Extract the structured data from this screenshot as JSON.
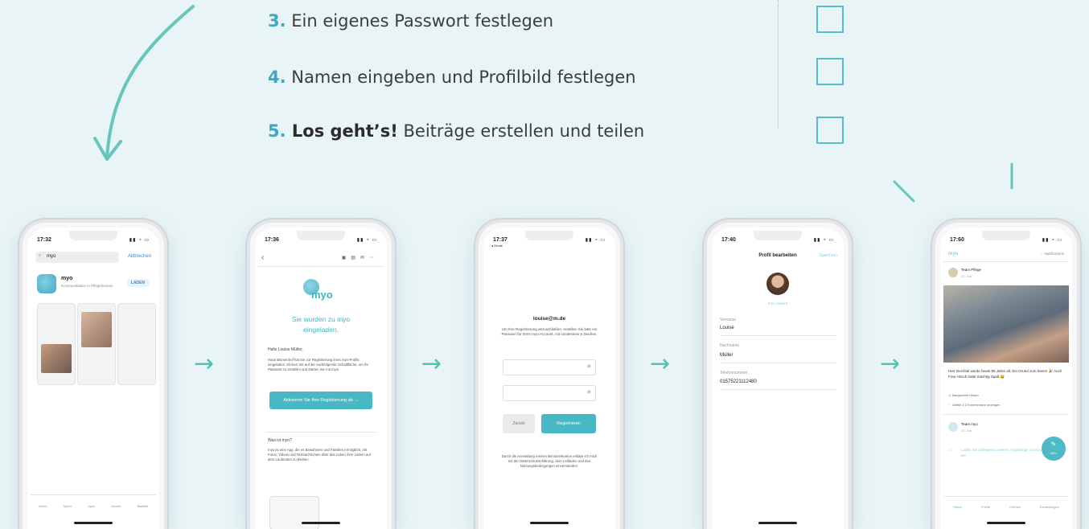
{
  "steps": [
    {
      "num": "3.",
      "bold": "",
      "text": " Ein eigenes Passwort festlegen"
    },
    {
      "num": "4.",
      "bold": "",
      "text": " Namen eingeben und Profilbild festlegen"
    },
    {
      "num": "5.",
      "bold": " Los geht’s!",
      "text": " Beiträge erstellen und teilen"
    }
  ],
  "arrow_glyph": "→",
  "colors": {
    "accent": "#3aa8c6",
    "teal": "#4fc3b3",
    "checkbox": "#5cb9d2"
  },
  "phone1": {
    "time": "17:32",
    "search_value": "myo",
    "cancel": "Abbrechen",
    "app_name": "myo",
    "app_sub": "Kommunikation in Pflegeheimen",
    "get": "LADEN",
    "tabs": [
      "Heute",
      "Spiele",
      "Apps",
      "Arcade",
      "Suchen"
    ]
  },
  "phone2": {
    "time": "17:36",
    "logo": "myo",
    "heading": "Sie wurden zu myo eingeladen.",
    "greeting": "Hallo Louise Müller,",
    "body": "Haus Blumenhof hat Sie zur Registrierung ihres myo-Profils eingeladen. Klicken Sie auf die nachfolgende Schaltfläche, um Ihr Passwort zu erstellen und starten Sie mit myo!",
    "button": "Aktivieren Sie Ihre Registrierung ab →",
    "what": "Was ist myo?",
    "what_body": "myo ist eine App, die es Bewohnern und Familien ermöglicht, mit Fotos, Videos und Textnachrichten über das Leben ihrer Lieben auf dem Laufenden zu bleiben."
  },
  "phone3": {
    "time": "17:37",
    "back": "◂ Gmail",
    "email": "louise@m.de",
    "instructions": "Um Ihre Registrierung abzuschließen, erstellen Sie bitte ein Passwort für Ihren myo-Account, mit mindestens 8 Zeichen.",
    "back_btn": "Zurück",
    "register_btn": "Registrieren",
    "legal": "Durch die Anmeldung meines Benutzerkontos erkläre ich mich mit der Datenschutzerklärung, dem Leitfaden und den Nutzungsbedingungen einverstanden."
  },
  "phone4": {
    "time": "17:40",
    "title": "Profil bearbeiten",
    "save": "Speichern",
    "change_photo": "Foto ändern",
    "firstname_label": "Vorname",
    "firstname": "Louise",
    "lastname_label": "Nachname",
    "lastname": "Müller",
    "phone_label": "Telefonnummer",
    "phone": "01575221112480"
  },
  "phone5": {
    "time": "17:60",
    "logo": "myo",
    "notifications": "Notifications",
    "team": "Team Pflege",
    "date": "20. Juli",
    "post": "Herr Deichtal wurde heute 95 Jahre alt. Ein Grund zum feiern! 🎉 Auch Frau Hirsch hatte mächtig Spaß 😀",
    "tagged": "Margarethe Hirsch",
    "likes": "Gefällt 3   2 Kommentare anzeigen",
    "team2": "Team myo",
    "date2": "20. Juli",
    "new": "NEU",
    "invite": "Laden Sie unbegrenzt weitere Angehörige zu myo ein",
    "tabs": [
      "Home",
      "Profile",
      "Dienste",
      "Einstellungen"
    ]
  }
}
